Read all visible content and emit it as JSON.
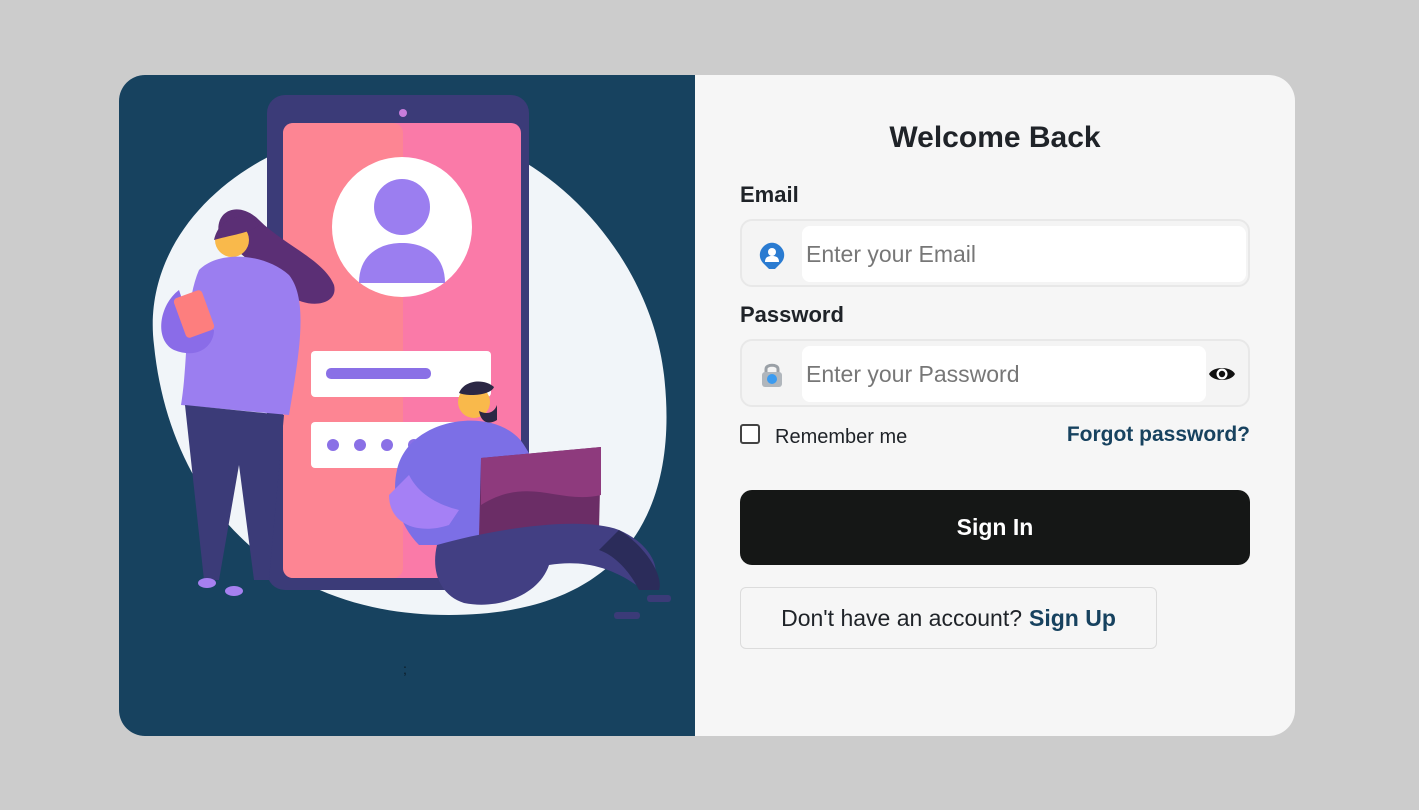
{
  "form": {
    "title": "Welcome Back",
    "email_label": "Email",
    "email_placeholder": "Enter your Email",
    "email_value": "",
    "password_label": "Password",
    "password_placeholder": "Enter your Password",
    "password_value": "",
    "remember_label": "Remember me",
    "remember_checked": false,
    "forgot_label": "Forgot password?",
    "signin_label": "Sign In",
    "signup_prompt": "Don't have an account?",
    "signup_link": "Sign Up"
  },
  "illustration": {
    "stray_text": ";",
    "icons": [
      "user-pin-icon",
      "padlock-icon",
      "eye-icon"
    ]
  },
  "colors": {
    "page_bg": "#cccccc",
    "panel_left": "#17425f",
    "panel_right": "#f6f6f6",
    "button": "#151716",
    "link": "#17425f",
    "accent_purple": "#9b7ef0"
  }
}
